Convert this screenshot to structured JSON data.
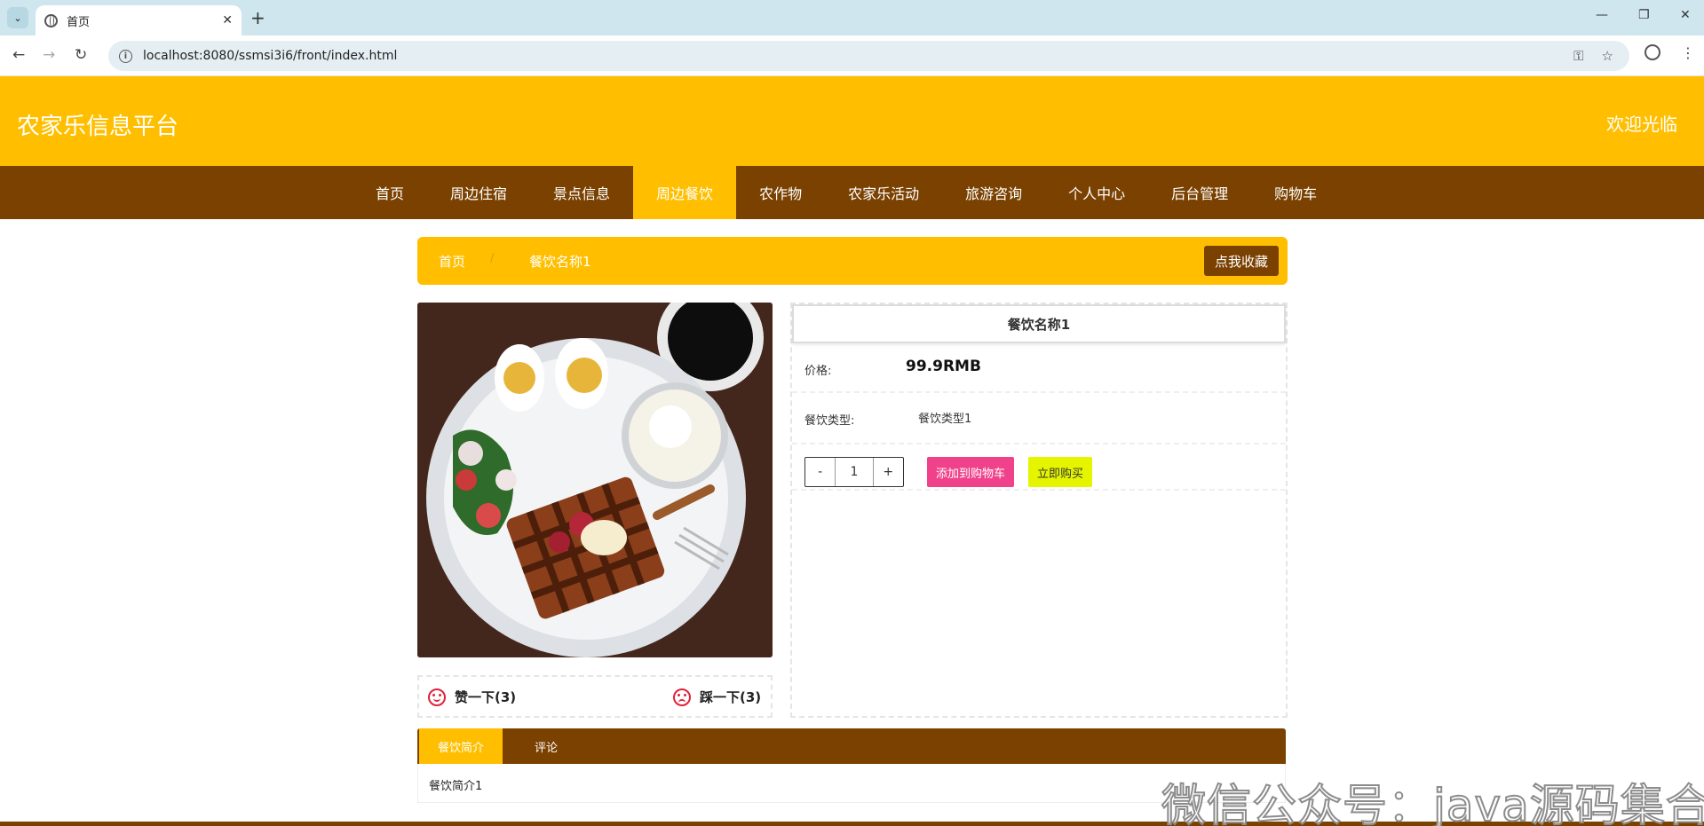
{
  "browser": {
    "tab_title": "首页",
    "tab_close": "✕",
    "new_tab": "+",
    "url": "localhost:8080/ssmsi3i6/front/index.html",
    "back": "←",
    "forward": "→",
    "reload": "↻",
    "minimize": "—",
    "restore": "❐",
    "close": "✕",
    "key_icon": "⚿",
    "star_icon": "☆",
    "menu_icon": "⋮",
    "dropdown": "⌄"
  },
  "header": {
    "site_title": "农家乐信息平台",
    "welcome": "欢迎光临"
  },
  "nav": {
    "items": [
      {
        "label": "首页"
      },
      {
        "label": "周边住宿"
      },
      {
        "label": "景点信息"
      },
      {
        "label": "周边餐饮",
        "active": true
      },
      {
        "label": "农作物"
      },
      {
        "label": "农家乐活动"
      },
      {
        "label": "旅游咨询"
      },
      {
        "label": "个人中心"
      },
      {
        "label": "后台管理"
      },
      {
        "label": "购物车"
      }
    ]
  },
  "breadcrumb": {
    "home": "首页",
    "separator": "/",
    "current": "餐饮名称1",
    "favorite_button": "点我收藏"
  },
  "votes": {
    "like_label": "赞一下(3)",
    "dislike_label": "踩一下(3)"
  },
  "detail": {
    "title": "餐饮名称1",
    "price_label": "价格:",
    "price_value": "99.9RMB",
    "type_label": "餐饮类型:",
    "type_value": "餐饮类型1",
    "qty_minus": "-",
    "qty_value": "1",
    "qty_plus": "+",
    "add_to_cart": "添加到购物车",
    "buy_now": "立即购买"
  },
  "info_tabs": {
    "tabs": [
      {
        "label": "餐饮简介",
        "active": true
      },
      {
        "label": "评论"
      }
    ],
    "body_text": "餐饮简介1"
  },
  "watermark": "微信公众号：java源码集合",
  "colors": {
    "accent_yellow": "#ffbf00",
    "nav_brown": "#7a4100",
    "cart_pink": "#f0428a",
    "buy_yellow": "#e5f500",
    "vote_red": "#e0213b"
  }
}
